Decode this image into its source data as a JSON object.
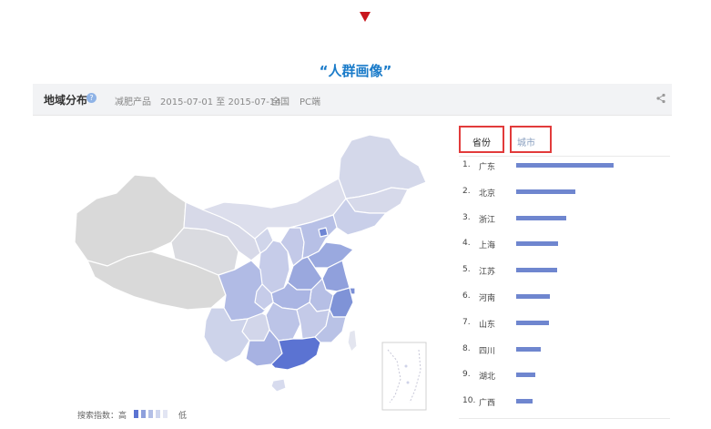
{
  "caption": "“人群画像”",
  "panel": {
    "title": "地域分布",
    "product": "减肥产品",
    "date_range": "2015-07-01 至 2015-07-14",
    "region": "全国",
    "device": "PC端"
  },
  "tabs": {
    "province": "省份",
    "city": "城市",
    "active": "province"
  },
  "ranking": [
    {
      "rank": "1.",
      "name": "广东",
      "share": 1.0
    },
    {
      "rank": "2.",
      "name": "北京",
      "share": 0.61
    },
    {
      "rank": "3.",
      "name": "浙江",
      "share": 0.51
    },
    {
      "rank": "4.",
      "name": "上海",
      "share": 0.43
    },
    {
      "rank": "5.",
      "name": "江苏",
      "share": 0.42
    },
    {
      "rank": "6.",
      "name": "河南",
      "share": 0.35
    },
    {
      "rank": "7.",
      "name": "山东",
      "share": 0.34
    },
    {
      "rank": "8.",
      "name": "四川",
      "share": 0.25
    },
    {
      "rank": "9.",
      "name": "湖北",
      "share": 0.2
    },
    {
      "rank": "10.",
      "name": "广西",
      "share": 0.17
    }
  ],
  "legend": {
    "label": "搜索指数：高",
    "low": "低",
    "colors": [
      "#5b73d2",
      "#8ea0dc",
      "#b3bfe6",
      "#cfd6ee",
      "#e2e5f3"
    ]
  },
  "colors": {
    "bar": "#6f86cf",
    "caption": "#1a7bc9",
    "tab_border": "#e23b3b",
    "map_high": "#5b73d2",
    "map_mid": "#9aa9df",
    "map_low": "#d3d8ec",
    "map_none": "#d8d8d8"
  },
  "icons": {
    "help": "question-circle-icon",
    "share": "share-icon",
    "marker": "down-triangle-icon"
  }
}
